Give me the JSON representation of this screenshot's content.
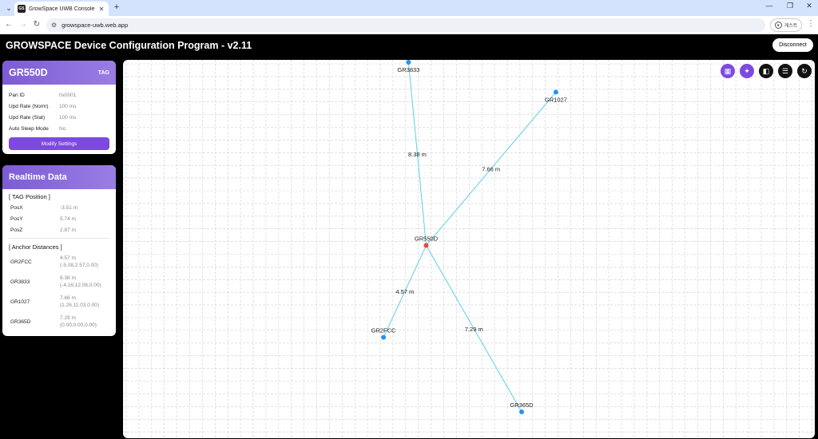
{
  "browser": {
    "tab_title": "GrowSpace UWB Console",
    "favicon_text": "GS",
    "url": "growspace-uwb.web.app",
    "profile_label": "게스트"
  },
  "app": {
    "title": "GROWSPACE Device Configuration Program - v2.11",
    "disconnect_label": "Disconnect"
  },
  "device": {
    "name": "GR550D",
    "type": "TAG",
    "rows": [
      {
        "label": "Pan ID",
        "value": "0x0001"
      },
      {
        "label": "Upd Rate (Norm)",
        "value": "100 ms"
      },
      {
        "label": "Upd Rate (Stat)",
        "value": "100 ms"
      },
      {
        "label": "Auto Sleep Mode",
        "value": "No"
      }
    ],
    "modify_label": "Modify Settings"
  },
  "realtime": {
    "title": "Realtime Data",
    "tag_section": "[ TAG Position ]",
    "position": [
      {
        "label": "PosX",
        "value": "-3.51 m"
      },
      {
        "label": "PosY",
        "value": "5.74 m"
      },
      {
        "label": "PosZ",
        "value": "2.87 m"
      }
    ],
    "anchor_section": "[ Anchor Distances ]",
    "anchors": [
      {
        "label": "GR2FCC",
        "dist": "4.57 m",
        "coord": "(-5.08,2.57,0.00)"
      },
      {
        "label": "GR3833",
        "dist": "8.38 m",
        "coord": "(-4.16,12.06,0.00)"
      },
      {
        "label": "GR1027",
        "dist": "7.66 m",
        "coord": "(1.26,11.03,0.00)"
      },
      {
        "label": "GR365D",
        "dist": "7.29 m",
        "coord": "(0.00,0.00,0.00)"
      }
    ]
  },
  "map": {
    "colors": {
      "anchor": "#2196f3",
      "tag": "#f44336",
      "line": "#5ecfe8",
      "grid": "#cfcfcf"
    },
    "tag": {
      "name": "GR550D",
      "x": -3.51,
      "y": 5.74
    },
    "anchors": [
      {
        "name": "GR3833",
        "x": -4.16,
        "y": 12.06,
        "dist": "8.38  m"
      },
      {
        "name": "GR1027",
        "x": 1.26,
        "y": 11.03,
        "dist": "7.66  m"
      },
      {
        "name": "GR2FCC",
        "x": -5.08,
        "y": 2.57,
        "dist": "4.57  m"
      },
      {
        "name": "GR365D",
        "x": 0.0,
        "y": 0.0,
        "dist": "7.29  m"
      }
    ],
    "tools": [
      {
        "name": "grid-icon",
        "style": "purple",
        "glyph": "▦"
      },
      {
        "name": "magic-wand-icon",
        "style": "purple",
        "glyph": "✦"
      },
      {
        "name": "compare-icon",
        "style": "black",
        "glyph": "◧"
      },
      {
        "name": "sliders-icon",
        "style": "black",
        "glyph": "☰"
      },
      {
        "name": "refresh-icon",
        "style": "black",
        "glyph": "↻"
      }
    ]
  }
}
